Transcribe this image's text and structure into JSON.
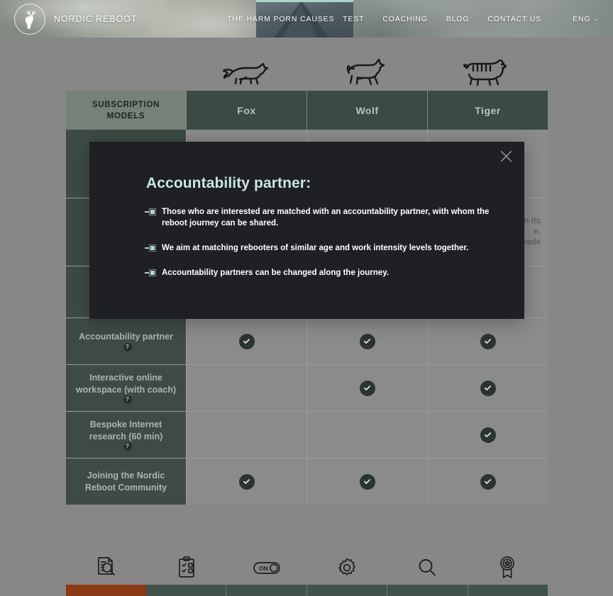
{
  "header": {
    "brand_name": "NORDIC REBOOT",
    "brand_icon": "reindeer-head-logo",
    "nav_primary": "THE HARM PORN CAUSES",
    "nav_items": [
      "TEST",
      "COACHING",
      "BLOG",
      "CONTACT US"
    ],
    "language": "ENG",
    "language_caret": "⌄",
    "accent_color": "#a9d6cb"
  },
  "animals": [
    {
      "name": "fox-icon"
    },
    {
      "name": "wolf-icon"
    },
    {
      "name": "tiger-icon"
    }
  ],
  "table": {
    "header_label": "SUBSCRIPTION MODELS",
    "columns": [
      "Fox",
      "Wolf",
      "Tiger"
    ],
    "header_bg": "#3c4a44",
    "label_bg": "#3e4b45",
    "rows": [
      {
        "label": "",
        "has_info": false,
        "cells": [
          "",
          "",
          ""
        ],
        "obscured": true
      },
      {
        "label": "",
        "has_info": false,
        "cells": [
          "",
          "",
          "n its\ne,\nvade"
        ],
        "obscured": true
      },
      {
        "label": "",
        "has_info": false,
        "cells": [
          "",
          "",
          ""
        ],
        "obscured": true
      },
      {
        "label": "Accountability partner",
        "has_info": true,
        "cells": [
          "check",
          "check",
          "check"
        ],
        "obscured": false
      },
      {
        "label": "Interactive online workspace (with coach)",
        "has_info": true,
        "cells": [
          "",
          "check",
          "check"
        ],
        "obscured": false
      },
      {
        "label": "Bespoke Internet research (60 min)",
        "has_info": true,
        "cells": [
          "",
          "",
          "check"
        ],
        "obscured": false
      },
      {
        "label": "Joining the Nordic Reboot Community",
        "has_info": false,
        "cells": [
          "check",
          "check",
          "check"
        ],
        "obscured": false
      }
    ],
    "info_badge": "?"
  },
  "footer_icons": [
    "document-search-icon",
    "clipboard-checklist-icon",
    "toggle-on-icon",
    "gear-icon",
    "magnifier-icon",
    "award-ribbon-icon"
  ],
  "bottom_bar": {
    "segments": 6,
    "accent_index": 0,
    "accent_color": "#8a3a14",
    "segment_color": "#42514a"
  },
  "modal": {
    "title": "Accountability partner:",
    "close_icon": "close-icon",
    "title_color": "#c8e7dd",
    "background": "#1e2023",
    "bullets": [
      "Those who are interested are matched with an accountability partner, with whom the reboot journey can be shared.",
      "We aim at matching rebooters of similar age and work intensity levels together.",
      "Accountability partners can be changed along the journey."
    ]
  }
}
